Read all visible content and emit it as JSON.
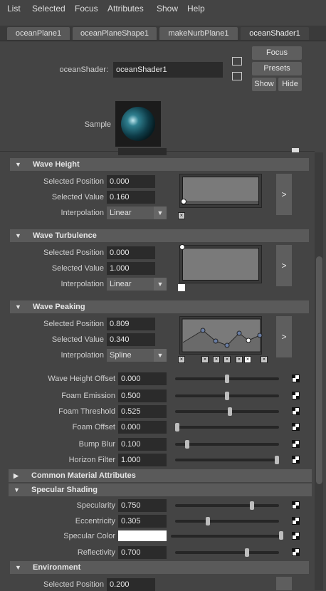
{
  "menubar": [
    "List",
    "Selected",
    "Focus",
    "Attributes",
    "Show",
    "Help"
  ],
  "tabs": [
    "oceanPlane1",
    "oceanPlaneShape1",
    "makeNurbPlane1",
    "oceanShader1"
  ],
  "header": {
    "shader_label": "oceanShader:",
    "shader_value": "oceanShader1",
    "focus": "Focus",
    "presets": "Presets",
    "show": "Show",
    "hide": "Hide",
    "sample_label": "Sample"
  },
  "wave_height": {
    "title": "Wave Height",
    "sel_pos_label": "Selected Position",
    "sel_pos": "0.000",
    "sel_val_label": "Selected Value",
    "sel_val": "0.160",
    "interp_label": "Interpolation",
    "interp": "Linear",
    "arrow": ">"
  },
  "wave_turbulence": {
    "title": "Wave Turbulence",
    "sel_pos_label": "Selected Position",
    "sel_pos": "0.000",
    "sel_val_label": "Selected Value",
    "sel_val": "1.000",
    "interp_label": "Interpolation",
    "interp": "Linear",
    "arrow": ">"
  },
  "wave_peaking": {
    "title": "Wave Peaking",
    "sel_pos_label": "Selected Position",
    "sel_pos": "0.809",
    "sel_val_label": "Selected Value",
    "sel_val": "0.340",
    "interp_label": "Interpolation",
    "interp": "Spline",
    "arrow": ">"
  },
  "sliders": [
    {
      "label": "Wave Height Offset",
      "value": "0.000",
      "level": 0.5
    },
    {
      "label": "Foam Emission",
      "value": "0.500",
      "level": 0.5
    },
    {
      "label": "Foam Threshold",
      "value": "0.525",
      "level": 0.525
    },
    {
      "label": "Foam Offset",
      "value": "0.000",
      "level": 0.0
    },
    {
      "label": "Bump Blur",
      "value": "0.100",
      "level": 0.1
    },
    {
      "label": "Horizon Filter",
      "value": "1.000",
      "level": 1.0
    }
  ],
  "common_material": {
    "title": "Common Material Attributes"
  },
  "specular": {
    "title": "Specular Shading",
    "rows": [
      {
        "label": "Specularity",
        "value": "0.750",
        "level": 0.75
      },
      {
        "label": "Eccentricity",
        "value": "0.305",
        "level": 0.305
      },
      {
        "label": "Specular Color",
        "value": "",
        "level": 1.0
      },
      {
        "label": "Reflectivity",
        "value": "0.700",
        "level": 0.7
      }
    ]
  },
  "environment": {
    "title": "Environment",
    "partial_label": "Selected Position",
    "partial_value": "0.200"
  },
  "colors": {
    "specular_color": "#ffffff"
  }
}
